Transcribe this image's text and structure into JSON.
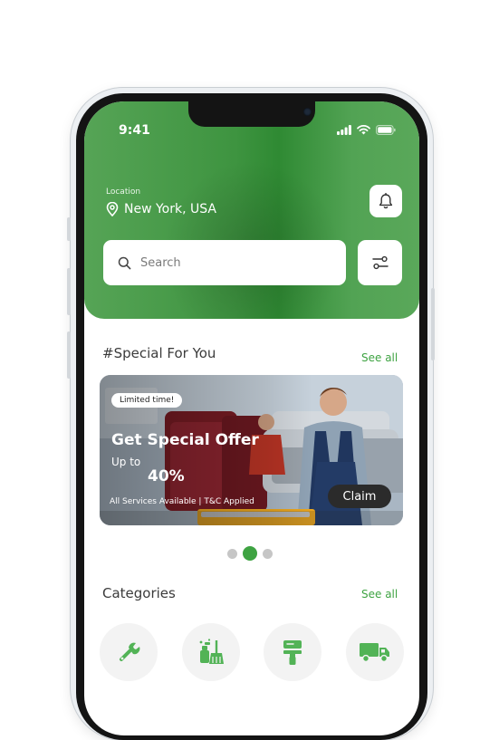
{
  "status_bar": {
    "time": "9:41"
  },
  "location": {
    "label": "Location",
    "value": "New York, USA"
  },
  "search": {
    "placeholder": "Search"
  },
  "special": {
    "title": "#Special For You",
    "see_all": "See all",
    "banner": {
      "badge": "Limited time!",
      "title": "Get Special Offer",
      "upto": "Up to",
      "percent": "40%",
      "note": "All Services Available | T&C Applied",
      "claim": "Claim"
    },
    "carousel": {
      "count": 3,
      "active_index": 1
    }
  },
  "categories": {
    "title": "Categories",
    "see_all": "See all",
    "items": [
      {
        "icon": "wrench-icon"
      },
      {
        "icon": "cleaning-icon"
      },
      {
        "icon": "paint-roller-icon"
      },
      {
        "icon": "delivery-truck-icon"
      }
    ]
  },
  "colors": {
    "accent": "#3ea342",
    "header_green": "#4a9e4c",
    "dark": "#2b2b2b"
  }
}
